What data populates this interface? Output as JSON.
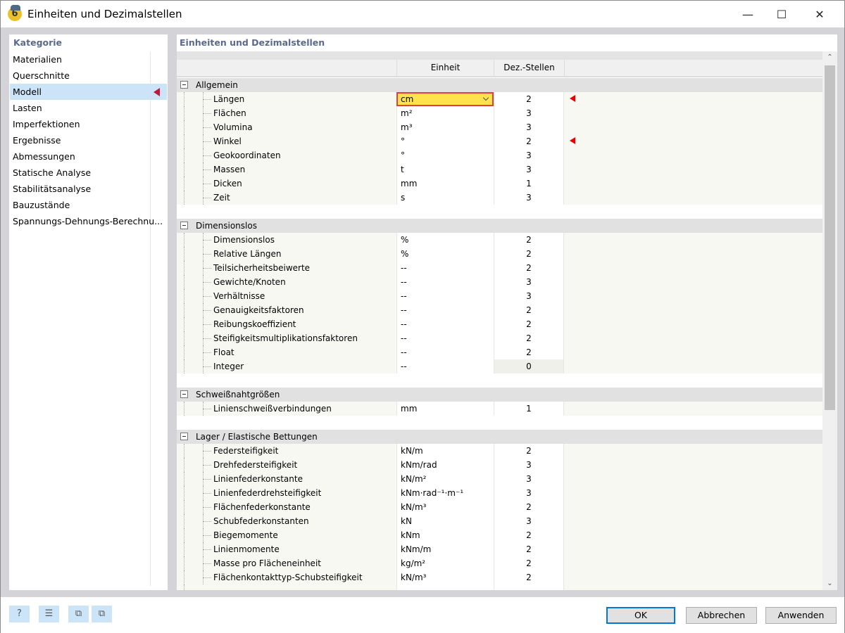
{
  "window": {
    "title": "Einheiten und Dezimalstellen",
    "app_icon": "rfem-6-icon",
    "minimize_icon": "minimize-icon",
    "maximize_icon": "maximize-icon",
    "close_icon": "close-icon"
  },
  "sidebar": {
    "title": "Kategorie",
    "selected": "Modell",
    "items": [
      {
        "label": "Materialien"
      },
      {
        "label": "Querschnitte"
      },
      {
        "label": "Modell",
        "selected": true
      },
      {
        "label": "Lasten"
      },
      {
        "label": "Imperfektionen"
      },
      {
        "label": "Ergebnisse"
      },
      {
        "label": "Abmessungen"
      },
      {
        "label": "Statische Analyse"
      },
      {
        "label": "Stabilitätsanalyse"
      },
      {
        "label": "Bauzustände"
      },
      {
        "label": "Spannungs-Dehnungs-Berechnu..."
      }
    ]
  },
  "main": {
    "title": "Einheiten und Dezimalstellen",
    "columns": {
      "unit": "Einheit",
      "decimals": "Dez.-Stellen"
    },
    "highlight_color": "#ffe34d",
    "modified_marker_color": "#e00000",
    "groups": [
      {
        "name": "Allgemein",
        "rows": [
          {
            "name": "Längen",
            "unit": "cm",
            "dec": "2",
            "selected": true,
            "modified": true
          },
          {
            "name": "Flächen",
            "unit": "m²",
            "dec": "3"
          },
          {
            "name": "Volumina",
            "unit": "m³",
            "dec": "3"
          },
          {
            "name": "Winkel",
            "unit": "°",
            "dec": "2",
            "modified": true
          },
          {
            "name": "Geokoordinaten",
            "unit": "°",
            "dec": "3"
          },
          {
            "name": "Massen",
            "unit": "t",
            "dec": "3"
          },
          {
            "name": "Dicken",
            "unit": "mm",
            "dec": "1"
          },
          {
            "name": "Zeit",
            "unit": "s",
            "dec": "3"
          }
        ]
      },
      {
        "name": "Dimensionslos",
        "rows": [
          {
            "name": "Dimensionslos",
            "unit": "%",
            "dec": "2"
          },
          {
            "name": "Relative Längen",
            "unit": "%",
            "dec": "2"
          },
          {
            "name": "Teilsicherheitsbeiwerte",
            "unit": "--",
            "dec": "2"
          },
          {
            "name": "Gewichte/Knoten",
            "unit": "--",
            "dec": "3"
          },
          {
            "name": "Verhältnisse",
            "unit": "--",
            "dec": "3"
          },
          {
            "name": "Genauigkeitsfaktoren",
            "unit": "--",
            "dec": "2"
          },
          {
            "name": "Reibungskoeffizient",
            "unit": "--",
            "dec": "2"
          },
          {
            "name": "Steifigkeitsmultiplikationsfaktoren",
            "unit": "--",
            "dec": "2"
          },
          {
            "name": "Float",
            "unit": "--",
            "dec": "2"
          },
          {
            "name": "Integer",
            "unit": "--",
            "dec": "0",
            "readonly": true
          }
        ]
      },
      {
        "name": "Schweißnahtgrößen",
        "rows": [
          {
            "name": "Linienschweißverbindungen",
            "unit": "mm",
            "dec": "1"
          }
        ]
      },
      {
        "name": "Lager / Elastische Bettungen",
        "rows": [
          {
            "name": "Federsteifigkeit",
            "unit": "kN/m",
            "dec": "2"
          },
          {
            "name": "Drehfedersteifigkeit",
            "unit": "kNm/rad",
            "dec": "3"
          },
          {
            "name": "Linienfederkonstante",
            "unit": "kN/m²",
            "dec": "3"
          },
          {
            "name": "Linienfederdrehsteifigkeit",
            "unit": "kNm·rad⁻¹·m⁻¹",
            "dec": "3"
          },
          {
            "name": "Flächenfederkonstante",
            "unit": "kN/m³",
            "dec": "2"
          },
          {
            "name": "Schubfederkonstanten",
            "unit": "kN",
            "dec": "3"
          },
          {
            "name": "Biegemomente",
            "unit": "kNm",
            "dec": "2"
          },
          {
            "name": "Linienmomente",
            "unit": "kNm/m",
            "dec": "2"
          },
          {
            "name": "Masse pro Flächeneinheit",
            "unit": "kg/m²",
            "dec": "2"
          },
          {
            "name": "Flächenkontakttyp-Schubsteifigkeit",
            "unit": "kN/m³",
            "dec": "2"
          }
        ]
      }
    ]
  },
  "footer": {
    "tools": [
      "help-icon",
      "database-copy-icon",
      "export-icon",
      "import-icon"
    ],
    "ok": "OK",
    "cancel": "Abbrechen",
    "apply": "Anwenden"
  }
}
